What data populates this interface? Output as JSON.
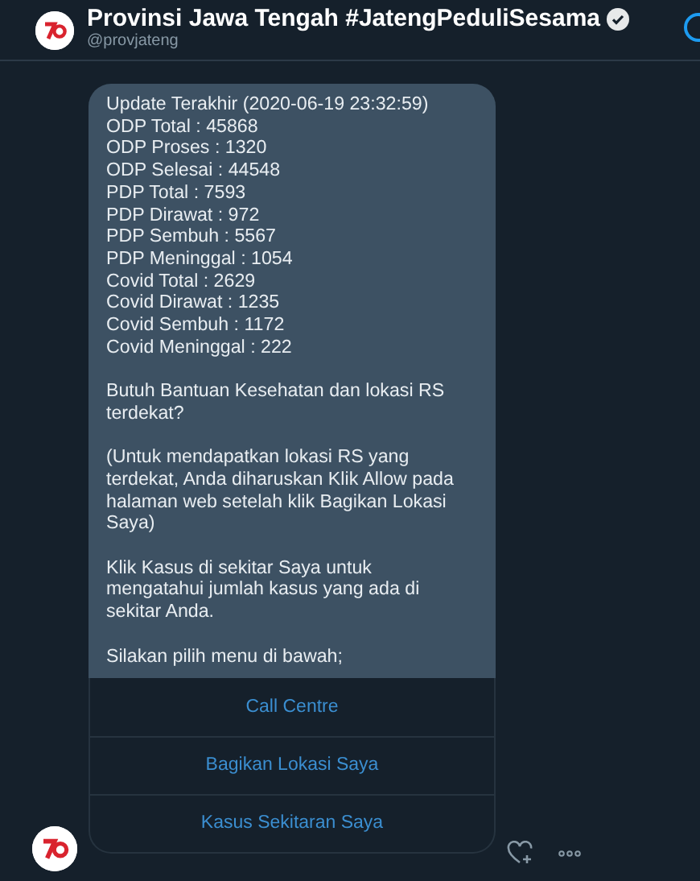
{
  "header": {
    "title": "Provinsi Jawa Tengah #JatengPeduliSesama",
    "handle": "@provjateng",
    "verified": true
  },
  "message": {
    "stats": [
      "Update Terakhir (2020-06-19 23:32:59)",
      "ODP Total : 45868",
      "ODP Proses : 1320",
      "ODP Selesai : 44548",
      "PDP Total : 7593",
      "PDP Dirawat : 972",
      "PDP Sembuh : 5567",
      "PDP Meninggal : 1054",
      "Covid Total : 2629",
      "Covid Dirawat : 1235",
      "Covid Sembuh : 1172",
      "Covid Meninggal : 222"
    ],
    "paragraphs": [
      "Butuh Bantuan Kesehatan dan lokasi RS terdekat?",
      "(Untuk mendapatkan lokasi RS yang terdekat, Anda diharuskan Klik Allow pada halaman web setelah klik Bagikan Lokasi Saya)",
      "Klik Kasus di sekitar Saya untuk mengatahui jumlah kasus yang ada di sekitar Anda.",
      "Silakan pilih menu di bawah;"
    ]
  },
  "buttons": [
    "Call Centre",
    "Bagikan Lokasi Saya",
    "Kasus Sekitaran Saya"
  ]
}
